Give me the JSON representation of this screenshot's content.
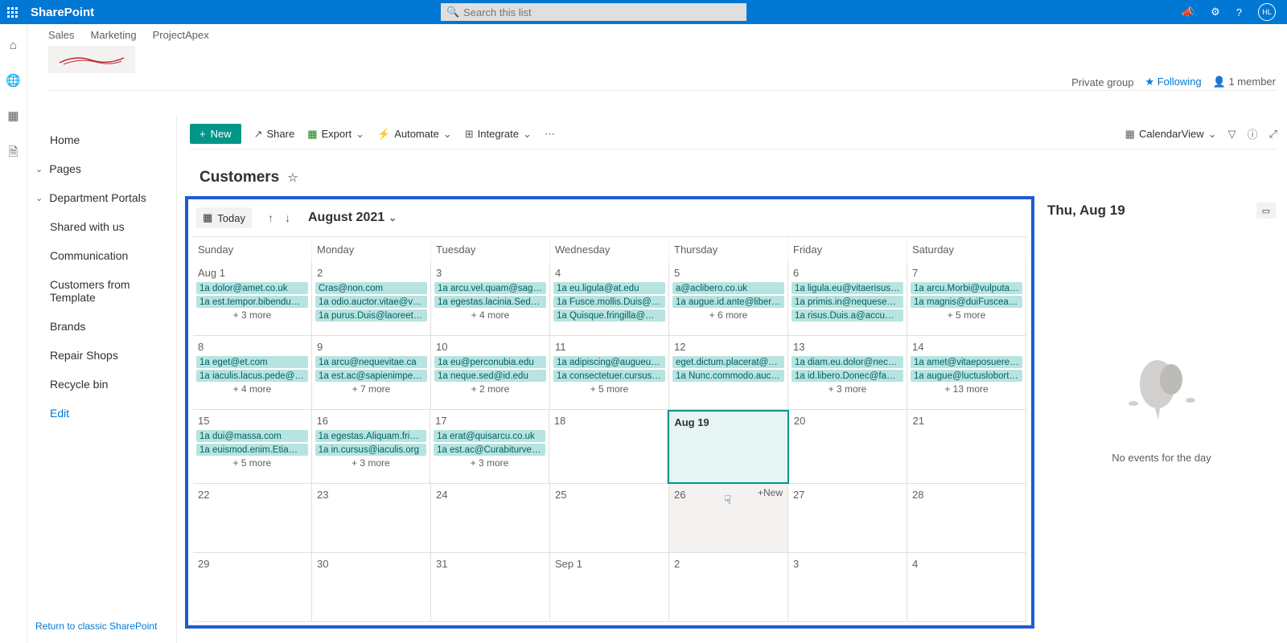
{
  "suite": {
    "brand": "SharePoint",
    "search_placeholder": "Search this list",
    "avatar": "HL"
  },
  "header": {
    "tabs": [
      "Sales",
      "Marketing",
      "ProjectApex"
    ],
    "private": "Private group",
    "following": "Following",
    "members": "1 member"
  },
  "leftnav": {
    "home": "Home",
    "pages": "Pages",
    "dept": "Department Portals",
    "items": [
      "Shared with us",
      "Communication",
      "Customers from Template",
      "Brands",
      "Repair Shops",
      "Recycle bin"
    ],
    "edit": "Edit",
    "classic": "Return to classic SharePoint"
  },
  "cmdbar": {
    "new": "New",
    "share": "Share",
    "export": "Export",
    "automate": "Automate",
    "integrate": "Integrate",
    "view": "CalendarView"
  },
  "list": {
    "title": "Customers"
  },
  "cal": {
    "today": "Today",
    "month": "August 2021",
    "dow": [
      "Sunday",
      "Monday",
      "Tuesday",
      "Wednesday",
      "Thursday",
      "Friday",
      "Saturday"
    ],
    "addnew": "+New",
    "weeks": [
      [
        {
          "label": "Aug 1",
          "ev": [
            "1a dolor@amet.co.uk",
            "1a est.tempor.bibendum…"
          ],
          "more": "+ 3 more"
        },
        {
          "label": "2",
          "ev": [
            "Cras@non.com",
            "1a odio.auctor.vitae@vel…",
            "1a purus.Duis@laoreetips…"
          ],
          "more": ""
        },
        {
          "label": "3",
          "ev": [
            "1a arcu.vel.quam@sagitti…",
            "1a egestas.lacinia.Sed@ve…"
          ],
          "more": "+ 4 more"
        },
        {
          "label": "4",
          "ev": [
            "1a eu.ligula@at.edu",
            "1a Fusce.mollis.Duis@orci…",
            "1a Quisque.fringilla@Mor…"
          ],
          "more": ""
        },
        {
          "label": "5",
          "ev": [
            "a@aclibero.co.uk",
            "1a augue.id.ante@libero…"
          ],
          "more": "+ 6 more"
        },
        {
          "label": "6",
          "ev": [
            "1a ligula.eu@vitaerisus.ca",
            "1a primis.in@nequesed.org",
            "1a risus.Duis.a@accumsa…"
          ],
          "more": ""
        },
        {
          "label": "7",
          "ev": [
            "1a arcu.Morbi@vulputate…",
            "1a magnis@duiFuscealiqu…"
          ],
          "more": "+ 5 more"
        }
      ],
      [
        {
          "label": "8",
          "ev": [
            "1a eget@et.com",
            "1a iaculis.lacus.pede@ultr…"
          ],
          "more": "+ 4 more"
        },
        {
          "label": "9",
          "ev": [
            "1a arcu@nequevitae.ca",
            "1a est.ac@sapienimperdi…"
          ],
          "more": "+ 7 more"
        },
        {
          "label": "10",
          "ev": [
            "1a eu@perconubia.edu",
            "1a neque.sed@id.edu"
          ],
          "more": "+ 2 more"
        },
        {
          "label": "11",
          "ev": [
            "1a adipiscing@augueut.ca",
            "1a consectetuer.cursus.et…"
          ],
          "more": "+ 5 more"
        },
        {
          "label": "12",
          "ev": [
            "eget.dictum.placerat@ma…",
            "1a Nunc.commodo.auctor…"
          ],
          "more": ""
        },
        {
          "label": "13",
          "ev": [
            "1a diam.eu.dolor@necme…",
            "1a id.libero.Donec@fauci…"
          ],
          "more": "+ 3 more"
        },
        {
          "label": "14",
          "ev": [
            "1a amet@vitaeposuereat…",
            "1a augue@luctuslobortis…"
          ],
          "more": "+ 13 more"
        }
      ],
      [
        {
          "label": "15",
          "ev": [
            "1a dui@massa.com",
            "1a euismod.enim.Etiam@…"
          ],
          "more": "+ 5 more"
        },
        {
          "label": "16",
          "ev": [
            "1a egestas.Aliquam.fringil…",
            "1a in.cursus@iaculis.org"
          ],
          "more": "+ 3 more"
        },
        {
          "label": "17",
          "ev": [
            "1a erat@quisarcu.co.uk",
            "1a est.ac@Curabiturvel.co…"
          ],
          "more": "+ 3 more"
        },
        {
          "label": "18",
          "ev": [],
          "more": ""
        },
        {
          "label": "Aug 19",
          "ev": [],
          "more": "",
          "selected": true
        },
        {
          "label": "20",
          "ev": [],
          "more": ""
        },
        {
          "label": "21",
          "ev": [],
          "more": ""
        }
      ],
      [
        {
          "label": "22",
          "ev": [],
          "more": ""
        },
        {
          "label": "23",
          "ev": [],
          "more": ""
        },
        {
          "label": "24",
          "ev": [],
          "more": ""
        },
        {
          "label": "25",
          "ev": [],
          "more": ""
        },
        {
          "label": "26",
          "ev": [],
          "more": "",
          "hover": true
        },
        {
          "label": "27",
          "ev": [],
          "more": ""
        },
        {
          "label": "28",
          "ev": [],
          "more": ""
        }
      ],
      [
        {
          "label": "29",
          "ev": [],
          "more": ""
        },
        {
          "label": "30",
          "ev": [],
          "more": ""
        },
        {
          "label": "31",
          "ev": [],
          "more": ""
        },
        {
          "label": "Sep 1",
          "ev": [],
          "more": ""
        },
        {
          "label": "2",
          "ev": [],
          "more": ""
        },
        {
          "label": "3",
          "ev": [],
          "more": ""
        },
        {
          "label": "4",
          "ev": [],
          "more": ""
        }
      ]
    ]
  },
  "detail": {
    "title": "Thu, Aug 19",
    "empty": "No events for the day"
  }
}
